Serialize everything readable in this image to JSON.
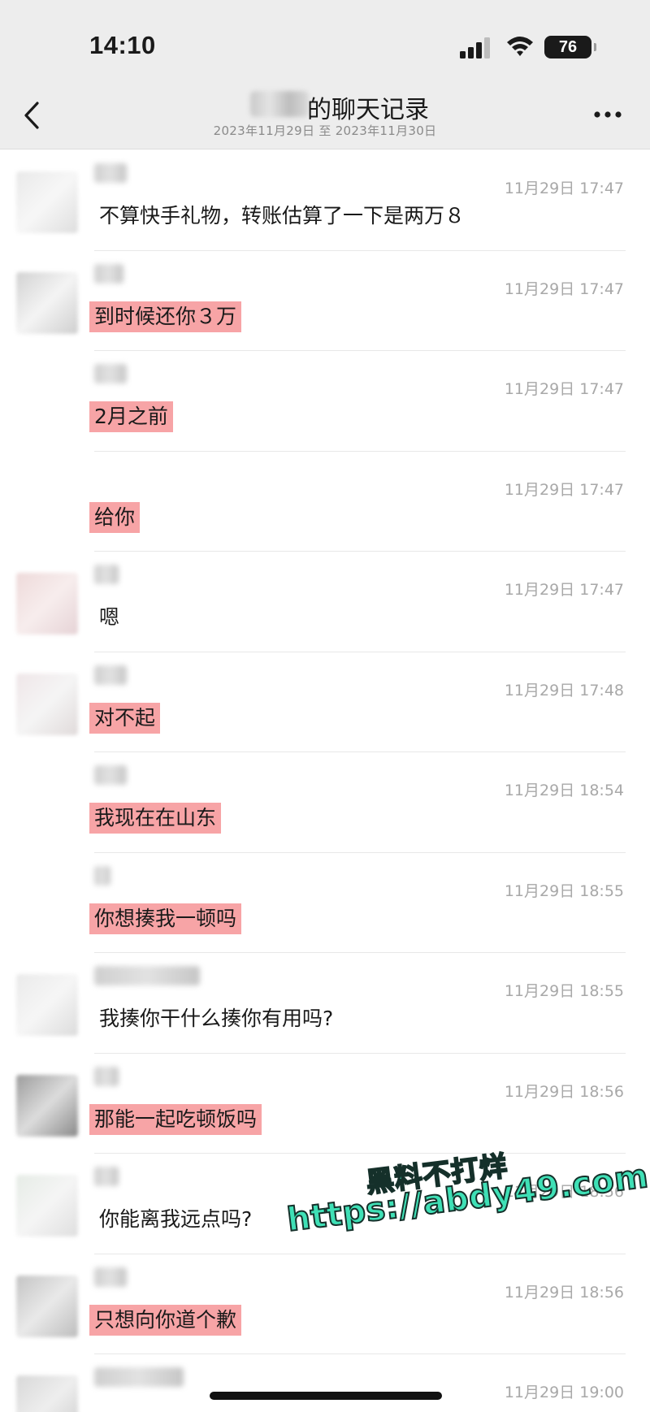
{
  "status_bar": {
    "time": "14:10",
    "battery": "76",
    "icons": [
      "signal-icon",
      "wifi-icon",
      "battery-icon"
    ]
  },
  "header": {
    "title": "的聊天记录",
    "subtitle": "2023年11月29日 至 2023年11月30日",
    "back_icon": "chevron-left-icon",
    "more_icon": "more-horizontal-icon"
  },
  "colors": {
    "highlight": "#f7a4a6",
    "header_bg": "#ededed",
    "watermark": "#3fe0b6"
  },
  "messages": [
    {
      "time": "11月29日 17:47",
      "text": "不算快手礼物，转账估算了一下是两万８",
      "highlighted": false
    },
    {
      "time": "11月29日 17:47",
      "text": "到时候还你３万",
      "highlighted": true
    },
    {
      "time": "11月29日 17:47",
      "text": "2月之前",
      "highlighted": true
    },
    {
      "time": "11月29日 17:47",
      "text": "给你",
      "highlighted": true
    },
    {
      "time": "11月29日 17:47",
      "text": "嗯",
      "highlighted": false
    },
    {
      "time": "11月29日 17:48",
      "text": "对不起",
      "highlighted": true
    },
    {
      "time": "11月29日 18:54",
      "text": "我现在在山东",
      "highlighted": true
    },
    {
      "time": "11月29日 18:55",
      "text": "你想揍我一顿吗",
      "highlighted": true
    },
    {
      "time": "11月29日 18:55",
      "text": "我揍你干什么揍你有用吗?",
      "highlighted": false
    },
    {
      "time": "11月29日 18:56",
      "text": "那能一起吃顿饭吗",
      "highlighted": true
    },
    {
      "time": "11月29日 18:56",
      "text": "你能离我远点吗?",
      "highlighted": false
    },
    {
      "time": "11月29日 18:56",
      "text": "只想向你道个歉",
      "highlighted": true
    },
    {
      "time": "11月29日 19:00",
      "text": "",
      "highlighted": false
    }
  ],
  "watermark": {
    "line1": "黑料不打烊",
    "line2": "https://abdy49.com"
  }
}
